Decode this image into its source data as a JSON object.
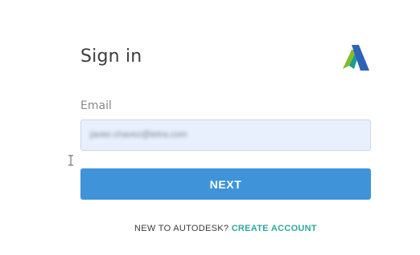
{
  "signin": {
    "title": "Sign in",
    "email_label": "Email",
    "email_value": "javier.chavez@tetra.com",
    "next_label": "NEXT",
    "new_user_prompt": "NEW TO AUTODESK?",
    "create_account_label": "CREATE ACCOUNT"
  },
  "brand": {
    "logo": "autodesk-logo",
    "colors": {
      "logo_green": "#86bc25",
      "logo_teal": "#1a9e8f",
      "logo_blue": "#2e62b8",
      "button": "#3f93d8",
      "link": "#2fa6a0",
      "input_bg": "#e8f0fe"
    }
  },
  "icons": {
    "text_cursor": "text-cursor-icon"
  }
}
